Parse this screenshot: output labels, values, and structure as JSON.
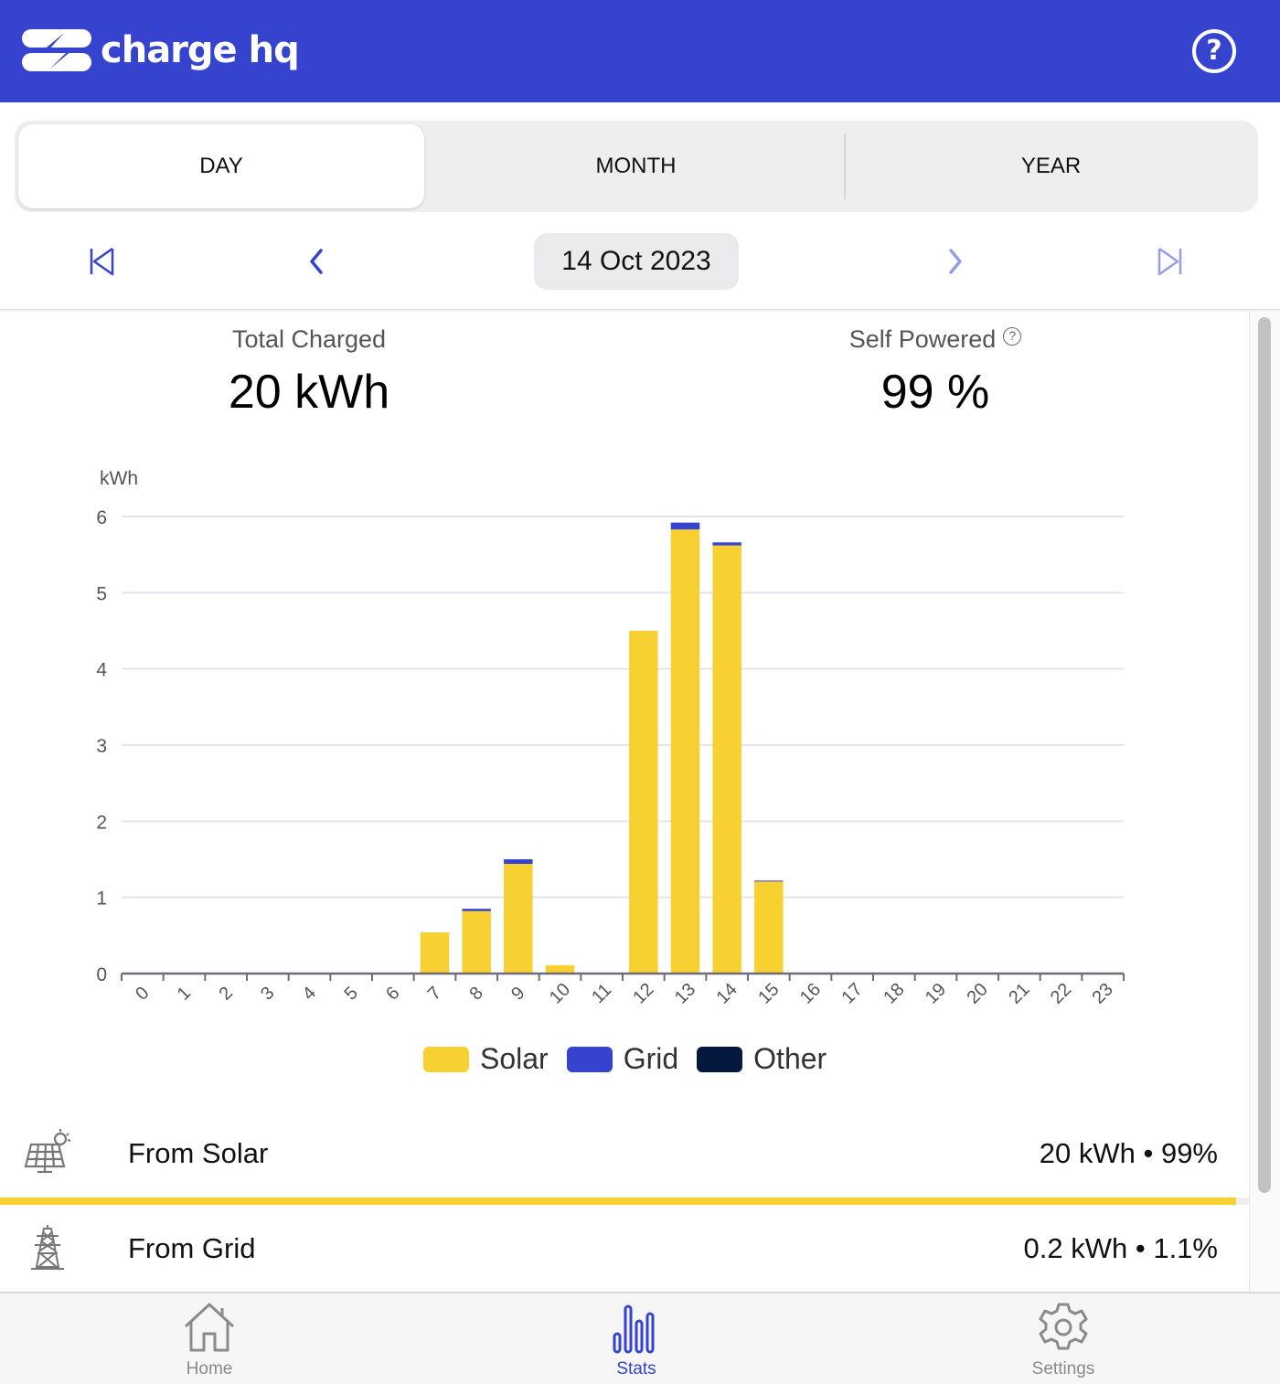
{
  "app": {
    "name": "charge hq",
    "brand_color": "#3643CE",
    "help_icon": "help-circle-icon"
  },
  "segments": {
    "items": [
      {
        "label": "DAY",
        "active": true
      },
      {
        "label": "MONTH",
        "active": false
      },
      {
        "label": "YEAR",
        "active": false
      }
    ]
  },
  "date_nav": {
    "first_icon": "skip-to-first-icon",
    "prev_icon": "chevron-left-icon",
    "date": "14 Oct 2023",
    "next_icon": "chevron-right-icon",
    "last_icon": "skip-to-last-icon"
  },
  "summary": {
    "total_label": "Total Charged",
    "total_value": "20 kWh",
    "self_label": "Self Powered",
    "self_help": "?",
    "self_value": "99 %"
  },
  "chart_data": {
    "type": "bar",
    "stacked": true,
    "title": "",
    "xlabel": "",
    "ylabel": "kWh",
    "ylim": [
      0,
      6
    ],
    "yticks": [
      0,
      1,
      2,
      3,
      4,
      5,
      6
    ],
    "grid": true,
    "legend_position": "bottom",
    "categories": [
      "0",
      "1",
      "2",
      "3",
      "4",
      "5",
      "6",
      "7",
      "8",
      "9",
      "10",
      "11",
      "12",
      "13",
      "14",
      "15",
      "16",
      "17",
      "18",
      "19",
      "20",
      "21",
      "22",
      "23"
    ],
    "series": [
      {
        "name": "Solar",
        "color": "#F7D131",
        "values": [
          0,
          0,
          0,
          0,
          0,
          0,
          0,
          0.54,
          0.82,
          1.44,
          0.11,
          0,
          4.5,
          5.83,
          5.62,
          1.21,
          0,
          0,
          0,
          0,
          0,
          0,
          0,
          0
        ]
      },
      {
        "name": "Grid",
        "color": "#3643CE",
        "values": [
          0,
          0,
          0,
          0,
          0,
          0,
          0,
          0,
          0.03,
          0.06,
          0,
          0,
          0,
          0.09,
          0.04,
          0.01,
          0,
          0,
          0,
          0,
          0,
          0,
          0,
          0
        ]
      },
      {
        "name": "Other",
        "color": "#05183D",
        "values": [
          0,
          0,
          0,
          0,
          0,
          0,
          0,
          0,
          0,
          0,
          0,
          0,
          0,
          0,
          0,
          0,
          0,
          0,
          0,
          0,
          0,
          0,
          0,
          0
        ]
      }
    ]
  },
  "breakdown": [
    {
      "label": "From Solar",
      "value": "20 kWh • 99%",
      "icon": "solar-panel-icon",
      "share": 0.99
    },
    {
      "label": "From Grid",
      "value": "0.2 kWh • 1.1%",
      "icon": "power-tower-icon",
      "share": 0.011
    }
  ],
  "tabbar": {
    "items": [
      {
        "label": "Home",
        "icon": "home-icon",
        "active": false
      },
      {
        "label": "Stats",
        "icon": "stats-icon",
        "active": true
      },
      {
        "label": "Settings",
        "icon": "gear-icon",
        "active": false
      }
    ]
  }
}
